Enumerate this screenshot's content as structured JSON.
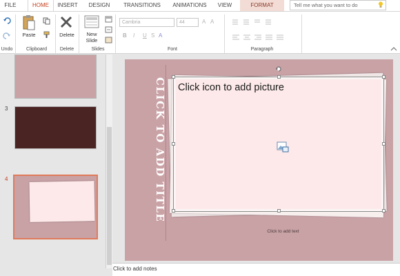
{
  "tabs": [
    {
      "label": "FILE"
    },
    {
      "label": "HOME"
    },
    {
      "label": "INSERT"
    },
    {
      "label": "DESIGN"
    },
    {
      "label": "TRANSITIONS"
    },
    {
      "label": "ANIMATIONS"
    },
    {
      "label": "VIEW"
    },
    {
      "label": "FORMAT"
    }
  ],
  "tell_me": {
    "placeholder": "Tell me what you want to do"
  },
  "ribbon": {
    "undo_group": "Undo",
    "clipboard": {
      "paste_label": "Paste",
      "group": "Clipboard"
    },
    "delete": {
      "delete_label": "Delete",
      "group": "Delete"
    },
    "slides": {
      "new_slide_label_1": "New",
      "new_slide_label_2": "Slide",
      "group": "Slides"
    },
    "font": {
      "family": "Cambria",
      "size": "44",
      "group": "Font",
      "bold": "B",
      "italic": "I",
      "underline": "U",
      "strike": "S",
      "color_letter": "A"
    },
    "paragraph": {
      "group": "Paragraph"
    }
  },
  "thumbnails": [
    {
      "number": ""
    },
    {
      "number": "3"
    },
    {
      "number": "4"
    }
  ],
  "slide": {
    "title_placeholder": "CLICK TO ADD TITLE",
    "picture_placeholder": "Click icon to add picture",
    "text_placeholder": "Click to add text"
  },
  "notes": {
    "placeholder": "Click to add notes"
  },
  "colors": {
    "accent": "#c43e1c",
    "slide_bg": "#c9a2a6",
    "thumb_dark": "#4a2323",
    "photo_fill": "#fde9e9"
  }
}
